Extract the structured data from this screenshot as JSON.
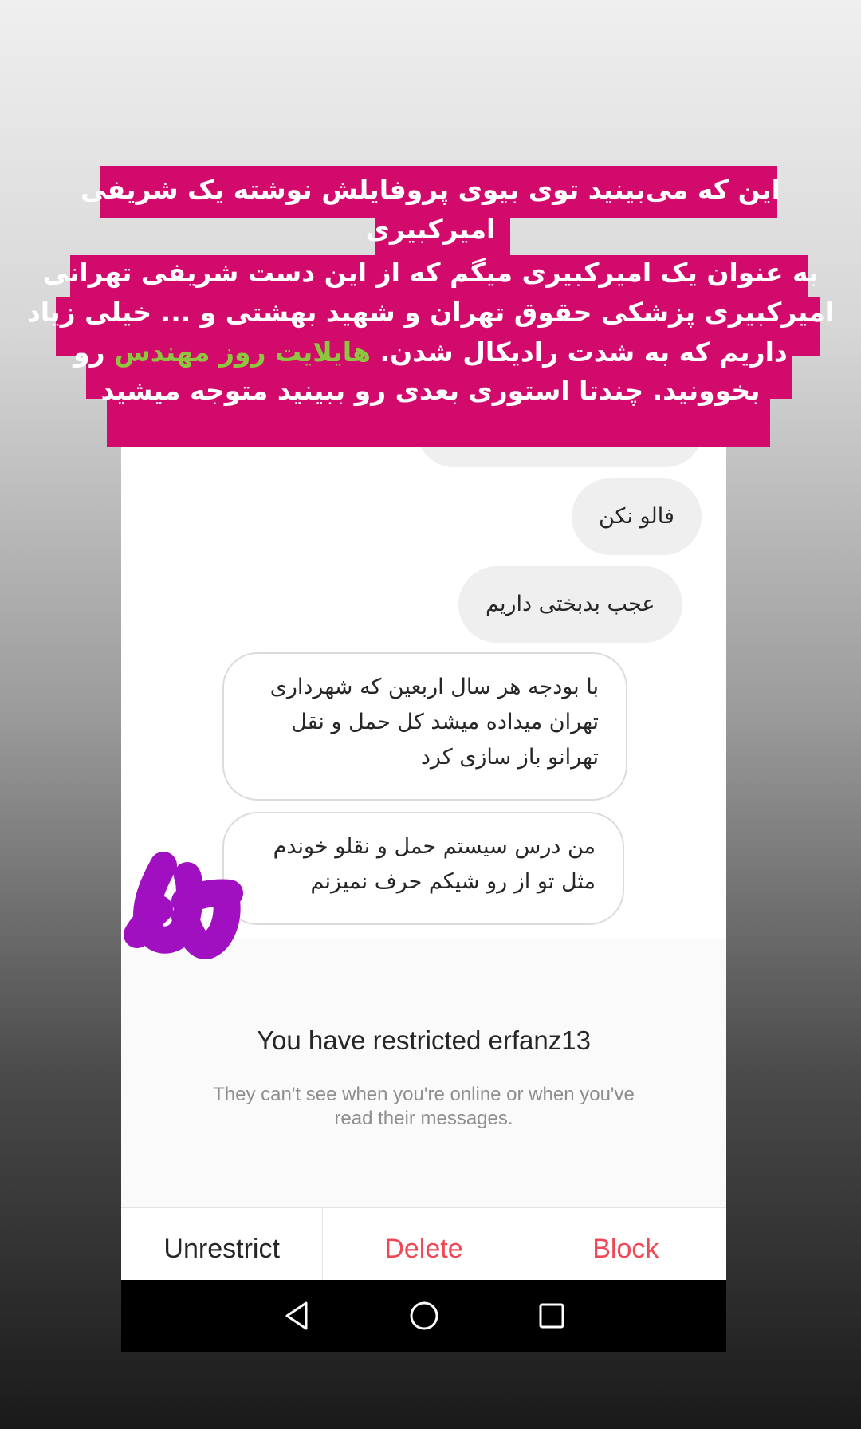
{
  "caption": {
    "line1": "این که می‌بینید توی بیوی پروفایلش نوشته یک شریفی",
    "line2": "امیرکبیری",
    "line3": "به عنوان یک امیرکبیری میگم که از این دست شریفی تهرانی",
    "line4": "امیرکبیری پزشکی حقوق تهران و شهید بهشتی و ... خیلی زیاد",
    "line5_part1": "داریم که به شدت رادیکال شدن.",
    "line5_highlight": "هایلایت روز مهندس",
    "line5_part2": "رو",
    "line6": "بخوونید. چندتا استوری بعدی رو ببینید متوجه میشید",
    "bg_color": "#d10a6b",
    "highlight_color": "#8dc63f"
  },
  "messages": [
    {
      "from": "me",
      "text": "فالو نکن"
    },
    {
      "from": "me",
      "text": "عجب بدبختی داریم"
    },
    {
      "from": "them",
      "lines": [
        "با بودجه هر سال اربعین که شهرداری",
        "تهران میداده میشد کل حمل و نقل",
        "تهرانو باز سازی کرد"
      ]
    },
    {
      "from": "them",
      "lines": [
        "من درس سیستم حمل و نقلو خوندم",
        "مثل تو از رو شیکم حرف نمیزنم"
      ]
    }
  ],
  "restriction": {
    "title": "You have restricted erfanz13",
    "subtitle": "They can't see when you're online or when you've read their messages."
  },
  "actions": {
    "unrestrict": "Unrestrict",
    "delete": "Delete",
    "block": "Block",
    "danger_color": "#ed4956"
  },
  "nav": {
    "back_icon": "triangle-back-icon",
    "home_icon": "circle-home-icon",
    "recents_icon": "square-recents-icon"
  },
  "doodle_color": "#a00fc0"
}
